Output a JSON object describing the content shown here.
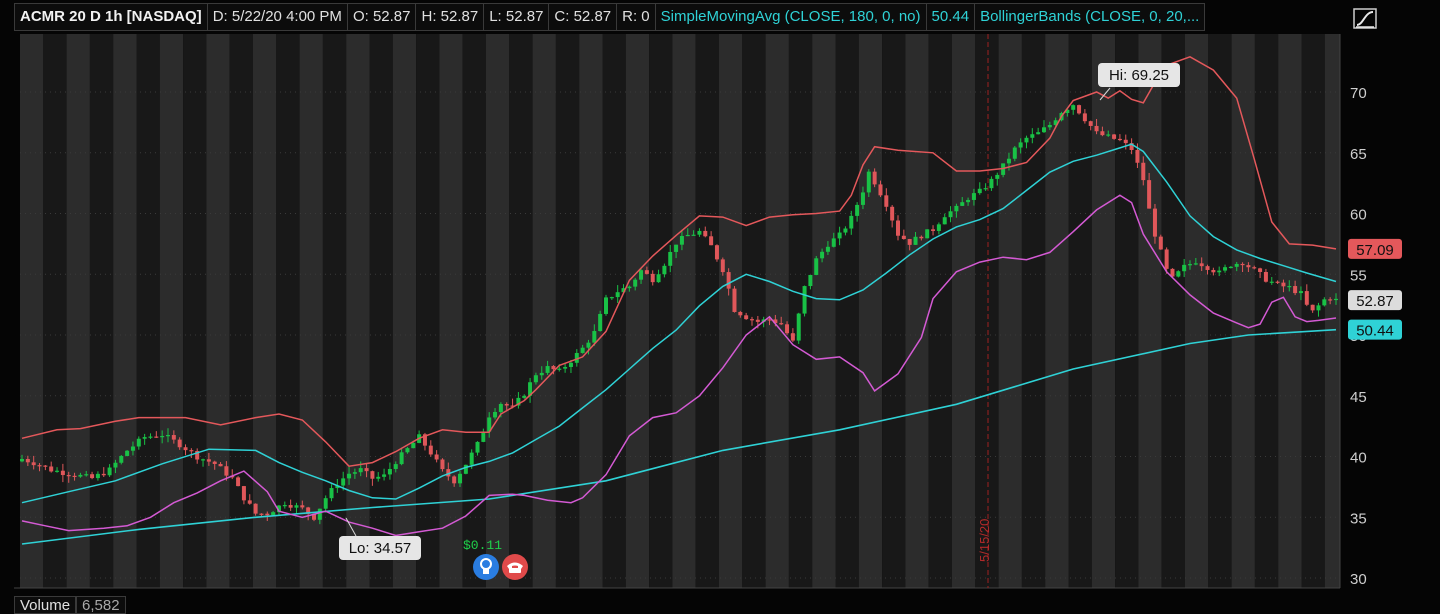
{
  "header": {
    "symbol_label": "ACMR 20 D 1h [NASDAQ]",
    "date_label": "D: 5/22/20 4:00 PM",
    "open_label": "O: 52.87",
    "high_label": "H: 52.87",
    "low_label": "L: 52.87",
    "close_label": "C: 52.87",
    "range_label": "R: 0",
    "sma_label": "SimpleMovingAvg (CLOSE, 180, 0, no)",
    "sma_value": "50.44",
    "bb_label": "BollingerBands (CLOSE, 0, 20,...",
    "toggle_icon": "trend-curve-icon"
  },
  "volume": {
    "label": "Volume",
    "value": "6,582"
  },
  "colors": {
    "background": "#050505",
    "session_band_light": "#2c2c2c",
    "session_band_dark": "#181818",
    "up_candle": "#19c146",
    "down_candle": "#e0575a",
    "bb_upper": "#e4585b",
    "bb_middle": "#2fd2d6",
    "bb_lower": "#d45ad4",
    "sma_180": "#2fd2d6",
    "date_marker": "#9e1f1f"
  },
  "chart_data": {
    "type": "candlestick",
    "symbol": "ACMR",
    "timeframe": "20 D 1h",
    "ylim": [
      29.5,
      73
    ],
    "yticks": [
      30,
      35,
      40,
      45,
      50,
      55,
      60,
      65,
      70
    ],
    "candle_count": 140,
    "vertical_marker_label": "5/15/20",
    "annotations": {
      "high": "Hi: 69.25",
      "low": "Lo: 34.57"
    },
    "event_labels": {
      "dividend": "$0.11",
      "dividend_icon": "lightbulb-icon",
      "earnings_icon": "phone-icon"
    },
    "price_labels": [
      {
        "name": "bb-upper",
        "value": 57.09,
        "text": "57.09"
      },
      {
        "name": "last-price",
        "value": 52.87,
        "text": "52.87"
      },
      {
        "name": "sma-180",
        "value": 50.44,
        "text": "50.44"
      }
    ],
    "close_series": [
      [
        0,
        39.8
      ],
      [
        2,
        39.5
      ],
      [
        5,
        38.9
      ],
      [
        8,
        38.6
      ],
      [
        12,
        38.2
      ],
      [
        15,
        38.9
      ],
      [
        18,
        40.5
      ],
      [
        21,
        41.6
      ],
      [
        24,
        41.8
      ],
      [
        27,
        41.0
      ],
      [
        30,
        40.0
      ],
      [
        33,
        39.4
      ],
      [
        36,
        38.2
      ],
      [
        38,
        36.6
      ],
      [
        40,
        35.3
      ],
      [
        42,
        35.3
      ],
      [
        45,
        36.2
      ],
      [
        48,
        35.7
      ],
      [
        50,
        35.0
      ],
      [
        52,
        36.6
      ],
      [
        54,
        37.8
      ],
      [
        56,
        38.6
      ],
      [
        58,
        38.9
      ],
      [
        60,
        38.2
      ],
      [
        62,
        38.4
      ],
      [
        64,
        39.6
      ],
      [
        66,
        40.6
      ],
      [
        68,
        41.6
      ],
      [
        70,
        40.3
      ],
      [
        72,
        38.8
      ],
      [
        74,
        38.0
      ],
      [
        76,
        39.4
      ],
      [
        78,
        41.0
      ],
      [
        80,
        43.4
      ],
      [
        82,
        44.4
      ],
      [
        84,
        44.0
      ],
      [
        86,
        45.2
      ],
      [
        88,
        46.8
      ],
      [
        90,
        47.3
      ],
      [
        92,
        47.0
      ],
      [
        94,
        47.9
      ],
      [
        96,
        48.9
      ],
      [
        98,
        50.2
      ],
      [
        100,
        52.9
      ],
      [
        102,
        53.6
      ],
      [
        104,
        54.0
      ],
      [
        106,
        55.3
      ],
      [
        108,
        54.6
      ],
      [
        110,
        55.9
      ],
      [
        112,
        57.6
      ],
      [
        114,
        58.2
      ],
      [
        116,
        58.5
      ],
      [
        118,
        57.3
      ],
      [
        120,
        55.4
      ],
      [
        121,
        53.8
      ],
      [
        122,
        52.1
      ],
      [
        124,
        51.5
      ],
      [
        126,
        51.1
      ],
      [
        128,
        51.3
      ],
      [
        130,
        50.9
      ],
      [
        132,
        49.4
      ],
      [
        134,
        53.9
      ],
      [
        136,
        56.2
      ],
      [
        138,
        57.5
      ],
      [
        140,
        58.2
      ],
      [
        142,
        59.6
      ],
      [
        144,
        61.9
      ],
      [
        145,
        63.4
      ],
      [
        146,
        62.6
      ],
      [
        148,
        60.8
      ],
      [
        150,
        58.3
      ],
      [
        152,
        57.6
      ],
      [
        154,
        58.2
      ],
      [
        156,
        58.7
      ],
      [
        158,
        59.9
      ],
      [
        160,
        60.4
      ],
      [
        162,
        61.3
      ],
      [
        164,
        61.8
      ],
      [
        166,
        62.7
      ],
      [
        168,
        63.9
      ],
      [
        170,
        65.3
      ],
      [
        172,
        66.2
      ],
      [
        174,
        66.6
      ],
      [
        176,
        67.3
      ],
      [
        178,
        68.4
      ],
      [
        180,
        69.0
      ],
      [
        182,
        67.8
      ],
      [
        184,
        66.6
      ],
      [
        186,
        66.3
      ],
      [
        188,
        66.0
      ],
      [
        190,
        65.3
      ],
      [
        192,
        62.8
      ],
      [
        193,
        60.3
      ],
      [
        194,
        58.3
      ],
      [
        195,
        56.8
      ],
      [
        196,
        55.3
      ],
      [
        197,
        54.6
      ],
      [
        199,
        55.6
      ],
      [
        201,
        56.1
      ],
      [
        203,
        55.6
      ],
      [
        205,
        55.1
      ],
      [
        207,
        55.8
      ],
      [
        209,
        56.0
      ],
      [
        211,
        55.3
      ],
      [
        213,
        54.6
      ],
      [
        215,
        54.1
      ],
      [
        217,
        53.9
      ],
      [
        219,
        53.4
      ],
      [
        220,
        52.4
      ],
      [
        221,
        51.9
      ],
      [
        222,
        52.4
      ],
      [
        223,
        52.9
      ],
      [
        224,
        53.1
      ],
      [
        225,
        52.87
      ]
    ],
    "bb_upper_series": [
      [
        0,
        41.5
      ],
      [
        6,
        42.2
      ],
      [
        10,
        42.3
      ],
      [
        16,
        42.9
      ],
      [
        20,
        43.2
      ],
      [
        28,
        43.2
      ],
      [
        34,
        42.6
      ],
      [
        40,
        43.2
      ],
      [
        44,
        43.5
      ],
      [
        48,
        43.0
      ],
      [
        52,
        41.2
      ],
      [
        56,
        39.2
      ],
      [
        60,
        39.5
      ],
      [
        64,
        40.4
      ],
      [
        68,
        41.5
      ],
      [
        72,
        42.2
      ],
      [
        76,
        42.0
      ],
      [
        80,
        42.0
      ],
      [
        82,
        43.5
      ],
      [
        86,
        44.6
      ],
      [
        88,
        45.5
      ],
      [
        92,
        47.5
      ],
      [
        96,
        48.2
      ],
      [
        100,
        50.3
      ],
      [
        104,
        54.5
      ],
      [
        108,
        56.5
      ],
      [
        112,
        58.2
      ],
      [
        116,
        59.8
      ],
      [
        120,
        59.7
      ],
      [
        124,
        59.0
      ],
      [
        128,
        59.7
      ],
      [
        132,
        59.9
      ],
      [
        136,
        60.0
      ],
      [
        140,
        60.2
      ],
      [
        142,
        61.5
      ],
      [
        144,
        64.0
      ],
      [
        146,
        65.5
      ],
      [
        150,
        65.2
      ],
      [
        156,
        65.0
      ],
      [
        160,
        63.5
      ],
      [
        164,
        63.5
      ],
      [
        168,
        63.7
      ],
      [
        172,
        64.2
      ],
      [
        176,
        66.2
      ],
      [
        178,
        68.0
      ],
      [
        180,
        69.3
      ],
      [
        184,
        70.0
      ],
      [
        186,
        69.5
      ],
      [
        188,
        70.1
      ],
      [
        190,
        69.4
      ],
      [
        192,
        69.1
      ],
      [
        194,
        70.8
      ],
      [
        196,
        72.2
      ],
      [
        200,
        72.9
      ],
      [
        204,
        71.8
      ],
      [
        208,
        69.5
      ],
      [
        211,
        64.5
      ],
      [
        214,
        59.3
      ],
      [
        217,
        57.5
      ],
      [
        221,
        57.4
      ],
      [
        225,
        57.09
      ]
    ],
    "bb_middle_series": [
      [
        0,
        36.2
      ],
      [
        8,
        37.1
      ],
      [
        16,
        38.0
      ],
      [
        24,
        39.4
      ],
      [
        32,
        40.6
      ],
      [
        40,
        40.5
      ],
      [
        44,
        39.5
      ],
      [
        48,
        38.7
      ],
      [
        52,
        38.0
      ],
      [
        56,
        37.2
      ],
      [
        60,
        36.6
      ],
      [
        64,
        36.5
      ],
      [
        68,
        37.4
      ],
      [
        72,
        38.4
      ],
      [
        76,
        39.1
      ],
      [
        80,
        39.6
      ],
      [
        84,
        40.3
      ],
      [
        88,
        41.4
      ],
      [
        92,
        42.5
      ],
      [
        96,
        44.0
      ],
      [
        100,
        45.5
      ],
      [
        104,
        47.2
      ],
      [
        108,
        48.9
      ],
      [
        112,
        50.4
      ],
      [
        116,
        52.4
      ],
      [
        120,
        54.0
      ],
      [
        124,
        55.0
      ],
      [
        128,
        54.4
      ],
      [
        132,
        53.6
      ],
      [
        136,
        53.0
      ],
      [
        140,
        52.9
      ],
      [
        144,
        53.7
      ],
      [
        148,
        55.1
      ],
      [
        152,
        56.6
      ],
      [
        156,
        57.9
      ],
      [
        160,
        58.9
      ],
      [
        164,
        59.5
      ],
      [
        168,
        60.4
      ],
      [
        172,
        61.9
      ],
      [
        176,
        63.4
      ],
      [
        180,
        64.3
      ],
      [
        184,
        64.8
      ],
      [
        188,
        65.4
      ],
      [
        190,
        65.7
      ],
      [
        192,
        65.1
      ],
      [
        196,
        62.6
      ],
      [
        200,
        59.8
      ],
      [
        204,
        58.1
      ],
      [
        208,
        57.0
      ],
      [
        212,
        56.3
      ],
      [
        216,
        55.7
      ],
      [
        220,
        55.1
      ],
      [
        225,
        54.4
      ]
    ],
    "bb_lower_series": [
      [
        0,
        34.7
      ],
      [
        4,
        34.3
      ],
      [
        8,
        33.9
      ],
      [
        14,
        34.1
      ],
      [
        18,
        34.3
      ],
      [
        22,
        35.0
      ],
      [
        26,
        36.2
      ],
      [
        30,
        37.0
      ],
      [
        34,
        38.0
      ],
      [
        38,
        38.8
      ],
      [
        42,
        37.1
      ],
      [
        44,
        35.5
      ],
      [
        48,
        35.0
      ],
      [
        52,
        35.5
      ],
      [
        56,
        34.6
      ],
      [
        60,
        34.1
      ],
      [
        64,
        33.5
      ],
      [
        68,
        33.8
      ],
      [
        72,
        34.1
      ],
      [
        76,
        35.1
      ],
      [
        80,
        36.8
      ],
      [
        84,
        36.9
      ],
      [
        86,
        36.8
      ],
      [
        90,
        36.4
      ],
      [
        94,
        36.2
      ],
      [
        96,
        36.6
      ],
      [
        100,
        38.5
      ],
      [
        104,
        41.7
      ],
      [
        108,
        43.2
      ],
      [
        112,
        43.6
      ],
      [
        116,
        45.0
      ],
      [
        120,
        47.3
      ],
      [
        124,
        50.0
      ],
      [
        128,
        51.5
      ],
      [
        132,
        49.2
      ],
      [
        136,
        48.0
      ],
      [
        140,
        48.2
      ],
      [
        144,
        46.9
      ],
      [
        146,
        45.4
      ],
      [
        150,
        46.8
      ],
      [
        154,
        49.8
      ],
      [
        156,
        53.0
      ],
      [
        160,
        55.2
      ],
      [
        164,
        56.0
      ],
      [
        168,
        56.4
      ],
      [
        172,
        56.2
      ],
      [
        176,
        56.8
      ],
      [
        180,
        58.5
      ],
      [
        184,
        60.3
      ],
      [
        188,
        61.5
      ],
      [
        190,
        60.9
      ],
      [
        192,
        58.3
      ],
      [
        196,
        55.2
      ],
      [
        200,
        53.3
      ],
      [
        204,
        51.8
      ],
      [
        208,
        51.0
      ],
      [
        210,
        50.6
      ],
      [
        212,
        50.9
      ],
      [
        214,
        52.7
      ],
      [
        216,
        53.1
      ],
      [
        218,
        51.5
      ],
      [
        220,
        51.1
      ],
      [
        222,
        51.2
      ],
      [
        225,
        51.4
      ]
    ],
    "sma_180_series": [
      [
        0,
        32.8
      ],
      [
        20,
        34.0
      ],
      [
        40,
        35.0
      ],
      [
        60,
        35.8
      ],
      [
        80,
        36.5
      ],
      [
        100,
        38.0
      ],
      [
        120,
        40.5
      ],
      [
        140,
        42.2
      ],
      [
        160,
        44.3
      ],
      [
        180,
        47.2
      ],
      [
        200,
        49.3
      ],
      [
        210,
        50.0
      ],
      [
        225,
        50.44
      ]
    ]
  }
}
